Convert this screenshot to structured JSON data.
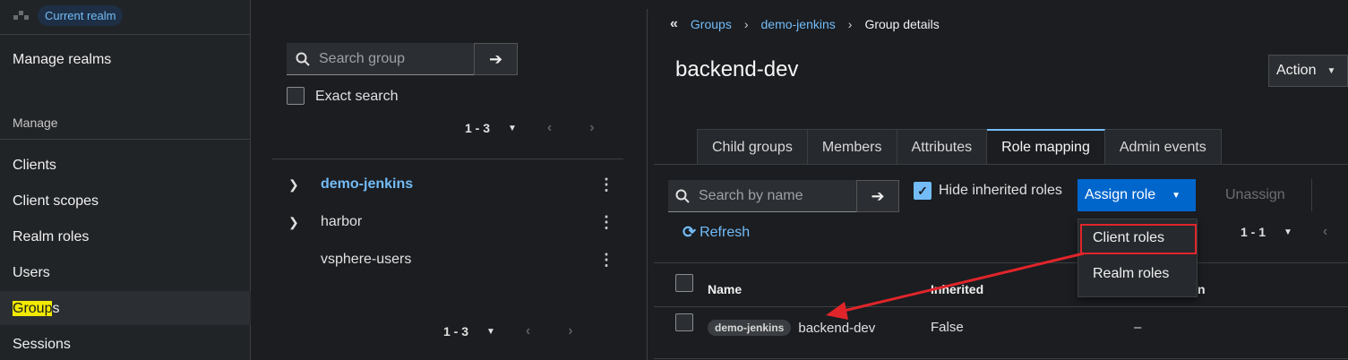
{
  "sidebar": {
    "realm_label": "Current realm",
    "manage_realms": "Manage realms",
    "section_manage": "Manage",
    "items": [
      "Clients",
      "Client scopes",
      "Realm roles",
      "Users",
      "Groups",
      "Sessions"
    ],
    "groups_highlight": "Group",
    "groups_rest": "s"
  },
  "tree": {
    "search_placeholder": "Search group",
    "exact_search": "Exact search",
    "pager_top": "1 - 3",
    "pager_bottom": "1 - 3",
    "groups": [
      "demo-jenkins",
      "harbor",
      "vsphere-users"
    ]
  },
  "breadcrumb": {
    "groups": "Groups",
    "parent": "demo-jenkins",
    "current": "Group details"
  },
  "page_title": "backend-dev",
  "action_label": "Action",
  "tabs": [
    "Child groups",
    "Members",
    "Attributes",
    "Role mapping",
    "Admin events"
  ],
  "toolbar": {
    "search_placeholder": "Search by name",
    "hide_inherited": "Hide inherited roles",
    "assign_role": "Assign role",
    "unassign": "Unassign",
    "refresh": "Refresh",
    "pager": "1 - 1"
  },
  "dropdown": {
    "client_roles": "Client roles",
    "realm_roles": "Realm roles"
  },
  "table": {
    "headers": {
      "name": "Name",
      "inherited": "Inherited",
      "description_partial": "n"
    },
    "rows": [
      {
        "client": "demo-jenkins",
        "name": "backend-dev",
        "inherited": "False",
        "description": "–"
      }
    ]
  },
  "colors": {
    "accent": "#73bcf7",
    "primary": "#0066cc",
    "annotation": "#e0252a",
    "highlight": "#f2ea00"
  }
}
